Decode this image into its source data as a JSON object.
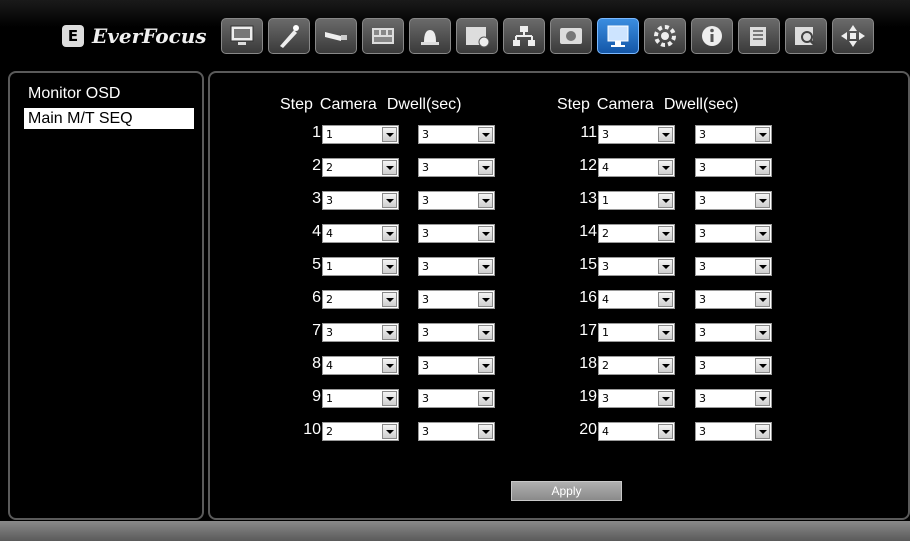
{
  "brand": {
    "logo_mark": "E",
    "name": "EverFocus"
  },
  "toolbar": {
    "buttons": [
      {
        "icon": "monitor-icon"
      },
      {
        "icon": "wizard-icon"
      },
      {
        "icon": "camera-icon"
      },
      {
        "icon": "record-icon"
      },
      {
        "icon": "alarm-icon"
      },
      {
        "icon": "schedule-icon"
      },
      {
        "icon": "network-icon"
      },
      {
        "icon": "disk-icon"
      },
      {
        "icon": "display-icon",
        "active": true
      },
      {
        "icon": "settings-gear-icon"
      },
      {
        "icon": "info-icon"
      },
      {
        "icon": "event-log-icon"
      },
      {
        "icon": "search-icon"
      },
      {
        "icon": "ptz-icon"
      }
    ]
  },
  "sidebar": {
    "items": [
      {
        "label": "Monitor OSD",
        "selected": false
      },
      {
        "label": "Main M/T SEQ",
        "selected": true
      }
    ]
  },
  "main": {
    "headers": {
      "step": "Step",
      "camera": "Camera",
      "dwell": "Dwell(sec)"
    },
    "steps": [
      {
        "step": "1",
        "camera": "1",
        "dwell": "3"
      },
      {
        "step": "2",
        "camera": "2",
        "dwell": "3"
      },
      {
        "step": "3",
        "camera": "3",
        "dwell": "3"
      },
      {
        "step": "4",
        "camera": "4",
        "dwell": "3"
      },
      {
        "step": "5",
        "camera": "1",
        "dwell": "3"
      },
      {
        "step": "6",
        "camera": "2",
        "dwell": "3"
      },
      {
        "step": "7",
        "camera": "3",
        "dwell": "3"
      },
      {
        "step": "8",
        "camera": "4",
        "dwell": "3"
      },
      {
        "step": "9",
        "camera": "1",
        "dwell": "3"
      },
      {
        "step": "10",
        "camera": "2",
        "dwell": "3"
      },
      {
        "step": "11",
        "camera": "3",
        "dwell": "3"
      },
      {
        "step": "12",
        "camera": "4",
        "dwell": "3"
      },
      {
        "step": "13",
        "camera": "1",
        "dwell": "3"
      },
      {
        "step": "14",
        "camera": "2",
        "dwell": "3"
      },
      {
        "step": "15",
        "camera": "3",
        "dwell": "3"
      },
      {
        "step": "16",
        "camera": "4",
        "dwell": "3"
      },
      {
        "step": "17",
        "camera": "1",
        "dwell": "3"
      },
      {
        "step": "18",
        "camera": "2",
        "dwell": "3"
      },
      {
        "step": "19",
        "camera": "3",
        "dwell": "3"
      },
      {
        "step": "20",
        "camera": "4",
        "dwell": "3"
      }
    ],
    "apply_label": "Apply"
  },
  "colors": {
    "active_tab": "#1a6fd0",
    "panel_border": "#5a5a5a",
    "background": "#000000"
  }
}
